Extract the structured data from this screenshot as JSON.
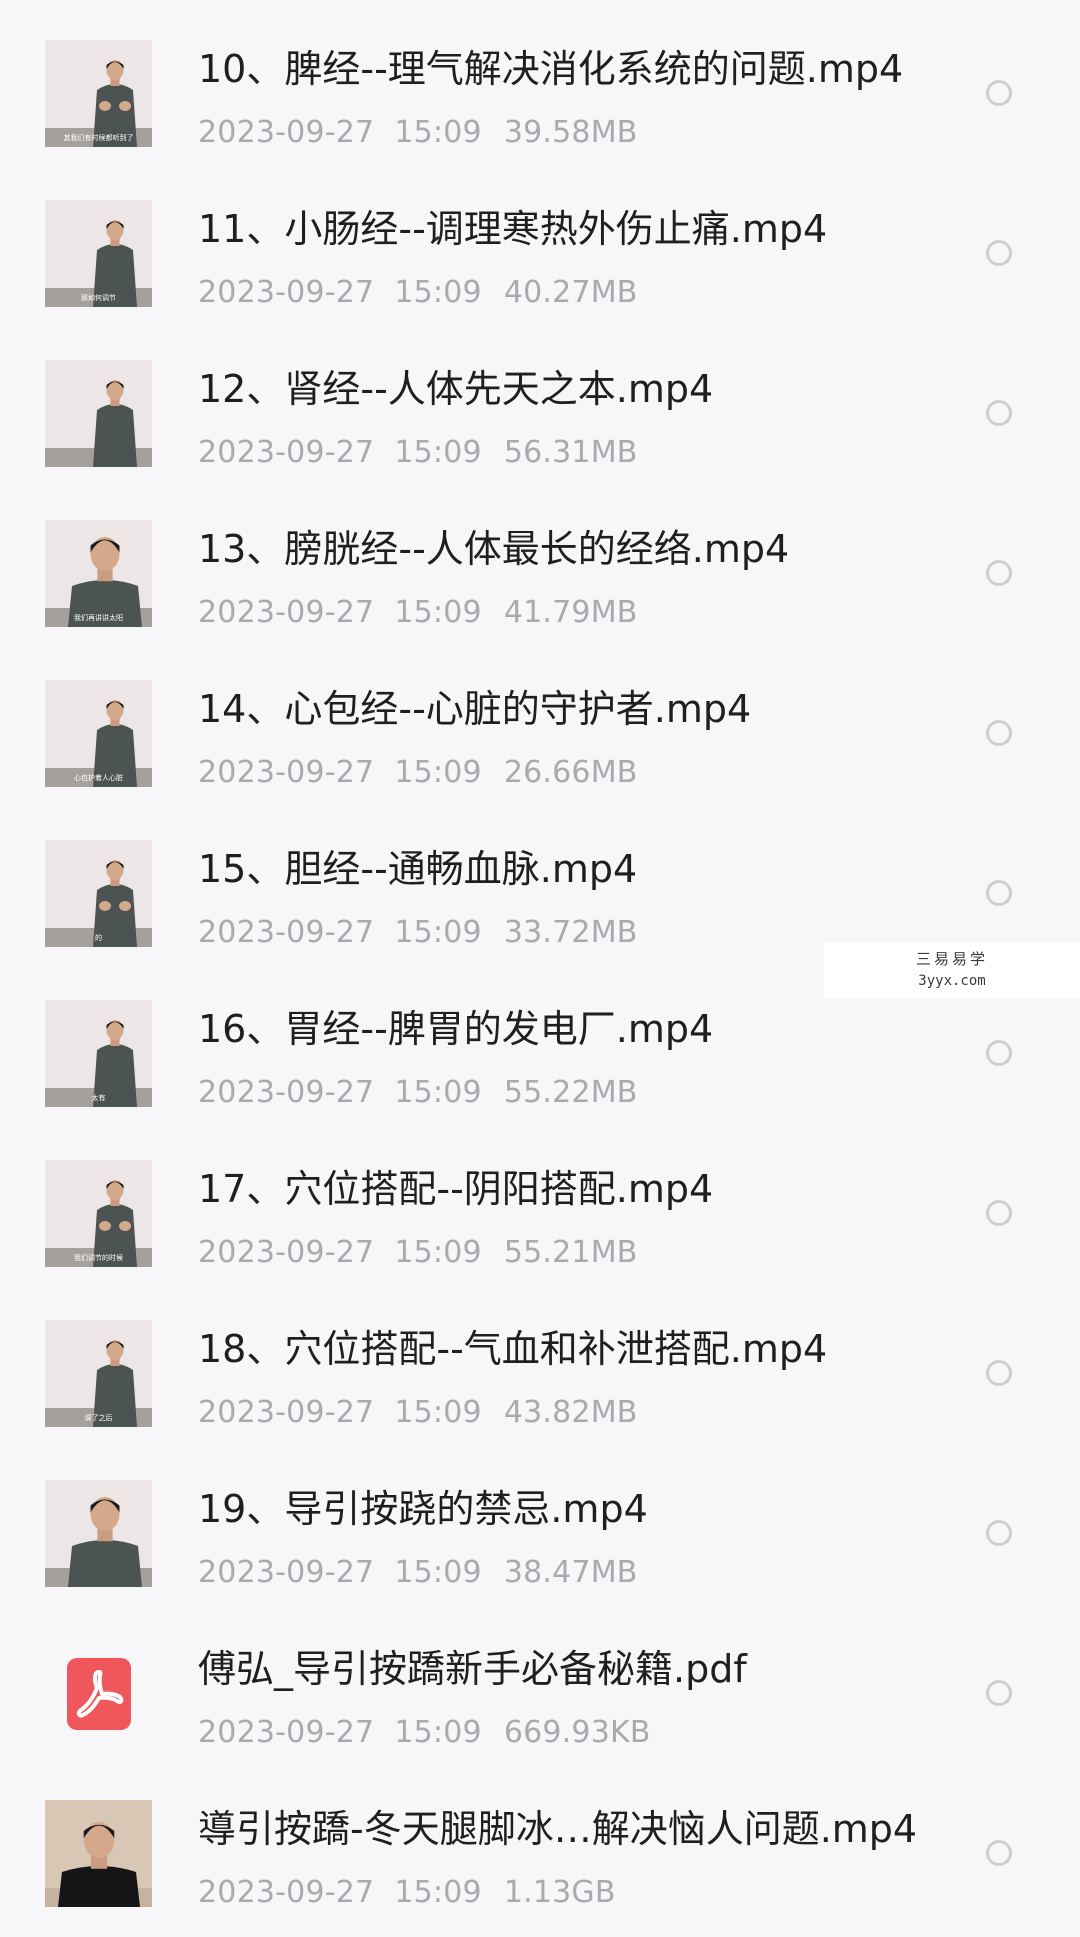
{
  "files": [
    {
      "name": "10、脾经--理气解决消化系统的问题.mp4",
      "date": "2023-09-27",
      "time": "15:09",
      "size": "39.58MB",
      "thumb": "video-thumbnail",
      "caption": "其我们有时候都听到了",
      "pose": "hands"
    },
    {
      "name": "11、小肠经--调理寒热外伤止痛.mp4",
      "date": "2023-09-27",
      "time": "15:09",
      "size": "40.27MB",
      "thumb": "video-thumbnail",
      "caption": "那如何调节",
      "pose": "standing"
    },
    {
      "name": "12、肾经--人体先天之本.mp4",
      "date": "2023-09-27",
      "time": "15:09",
      "size": "56.31MB",
      "thumb": "video-thumbnail",
      "caption": "",
      "pose": "standing"
    },
    {
      "name": "13、膀胱经--人体最长的经络.mp4",
      "date": "2023-09-27",
      "time": "15:09",
      "size": "41.79MB",
      "thumb": "video-thumbnail",
      "caption": "我们再讲讲太阳",
      "pose": "closeup"
    },
    {
      "name": "14、心包经--心脏的守护者.mp4",
      "date": "2023-09-27",
      "time": "15:09",
      "size": "26.66MB",
      "thumb": "video-thumbnail",
      "caption": "心包护着人心脏",
      "pose": "standing"
    },
    {
      "name": "15、胆经--通畅血脉.mp4",
      "date": "2023-09-27",
      "time": "15:09",
      "size": "33.72MB",
      "thumb": "video-thumbnail",
      "caption": "的",
      "pose": "hands"
    },
    {
      "name": "16、胃经--脾胃的发电厂.mp4",
      "date": "2023-09-27",
      "time": "15:09",
      "size": "55.22MB",
      "thumb": "video-thumbnail",
      "caption": "太有",
      "pose": "standing"
    },
    {
      "name": "17、穴位搭配--阴阳搭配.mp4",
      "date": "2023-09-27",
      "time": "15:09",
      "size": "55.21MB",
      "thumb": "video-thumbnail",
      "caption": "我们调节的时候",
      "pose": "hands"
    },
    {
      "name": "18、穴位搭配--气血和补泄搭配.mp4",
      "date": "2023-09-27",
      "time": "15:09",
      "size": "43.82MB",
      "thumb": "video-thumbnail",
      "caption": "调了之后",
      "pose": "standing"
    },
    {
      "name": "19、导引按跷的禁忌.mp4",
      "date": "2023-09-27",
      "time": "15:09",
      "size": "38.47MB",
      "thumb": "video-thumbnail",
      "caption": "",
      "pose": "closeup"
    },
    {
      "name": "傅弘_导引按蹻新手必备秘籍.pdf",
      "date": "2023-09-27",
      "time": "15:09",
      "size": "669.93KB",
      "thumb": "pdf-icon",
      "caption": "",
      "pose": ""
    },
    {
      "name": "導引按蹻-冬天腿脚冰…解决恼人问题.mp4",
      "date": "2023-09-27",
      "time": "15:09",
      "size": "1.13GB",
      "thumb": "video-thumbnail",
      "caption": "",
      "pose": "facing"
    }
  ],
  "watermark": {
    "line1": "三易易学",
    "line2": "3yyx.com"
  },
  "colors": {
    "background": "#f7f7f9",
    "name_text": "#1f1f1f",
    "meta_text": "#a9a9ae",
    "radio_border": "#cfcfd3",
    "pdf_red": "#f0575c"
  }
}
